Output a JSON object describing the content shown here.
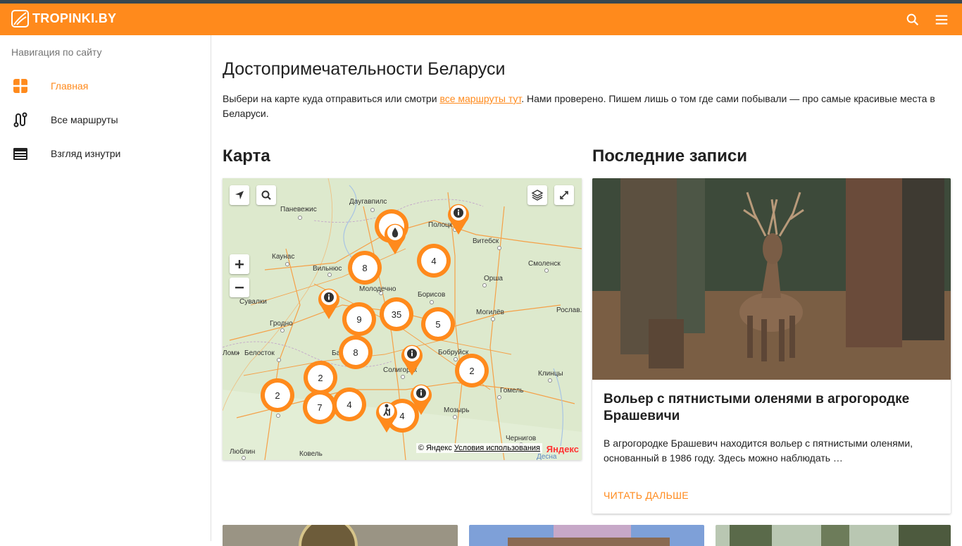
{
  "header": {
    "logo_text": "TROPINKI.BY",
    "search_icon": "search-icon",
    "menu_icon": "menu-icon",
    "accent_color": "#ff8a1c"
  },
  "sidebar": {
    "header": "Навигация по сайту",
    "items": [
      {
        "label": "Главная",
        "icon": "tropinki-logo-icon",
        "active": true
      },
      {
        "label": "Все маршруты",
        "icon": "route-icon",
        "active": false
      },
      {
        "label": "Взгляд изнутри",
        "icon": "calendar-view-icon",
        "active": false
      }
    ]
  },
  "main": {
    "title": "Достопримечательности Беларуси",
    "intro_before": "Выбери на карте куда отправиться или смотри ",
    "intro_link": "все маршруты тут",
    "intro_after": ". Нами проверено. Пишем лишь о том где сами побывали — про самые красивые места в Беларуси."
  },
  "map": {
    "section_title": "Карта",
    "cities": [
      "Паневежис",
      "Даугавпилс",
      "Полоцк",
      "Витебск",
      "Каунас",
      "Вильнюс",
      "Смоленск",
      "Молодечно",
      "Орша",
      "Сувалки",
      "Борисов",
      "Могилёв",
      "Рослав.",
      "Гродно",
      "Белосток",
      "Бобруйск",
      "Солигорск",
      "Клинцы",
      "Гомель",
      "Мозырь",
      "Чернигов",
      "Люблин",
      "Ковель",
      "Ломжа",
      "Барановичи",
      "Десна"
    ],
    "clusters": [
      "8",
      "4",
      "9",
      "35",
      "5",
      "8",
      "2",
      "2",
      "2",
      "7",
      "4",
      "4"
    ],
    "pins": [
      "info-icon",
      "drop-icon",
      "info-icon",
      "info-icon",
      "info-icon",
      "hiker-icon"
    ],
    "controls": [
      "geolocation-icon",
      "search-icon",
      "layers-icon",
      "fullscreen-icon",
      "zoom-in-icon",
      "zoom-out-icon"
    ],
    "copyright": "© Яндекс",
    "terms_link": "Условия использования",
    "provider_logo": "Яндекс"
  },
  "latest": {
    "section_title": "Последние записи",
    "card": {
      "title": "Вольер с пятнистыми оленями в агрогородке Брашевичи",
      "text": "В агрогородке Брашевич находится вольер с пятнистыми оленями, основанный в 1986 году. Здесь можно наблюдать …",
      "action": "ЧИТАТЬ ДАЛЬШЕ"
    }
  }
}
